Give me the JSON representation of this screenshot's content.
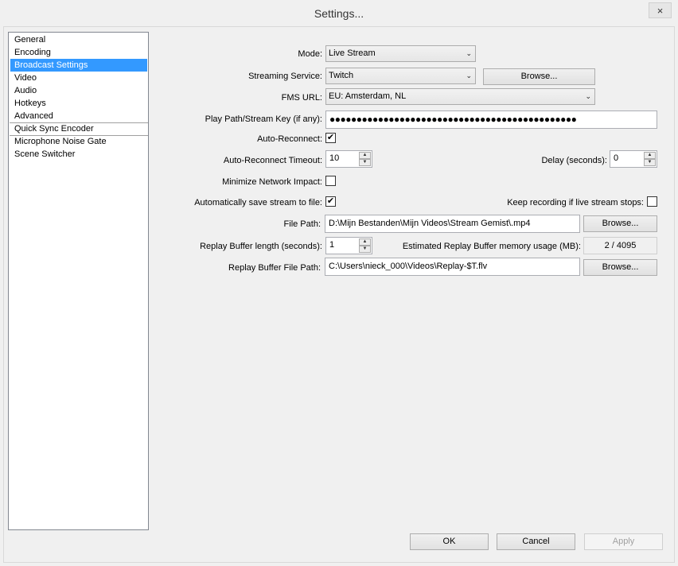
{
  "window": {
    "title": "Settings...",
    "close_glyph": "×"
  },
  "nav": {
    "items": [
      {
        "label": "General"
      },
      {
        "label": "Encoding"
      },
      {
        "label": "Broadcast Settings"
      },
      {
        "label": "Video"
      },
      {
        "label": "Audio"
      },
      {
        "label": "Hotkeys"
      },
      {
        "label": "Advanced"
      },
      {
        "label": "Quick Sync Encoder"
      },
      {
        "label": "Microphone Noise Gate"
      },
      {
        "label": "Scene Switcher"
      }
    ],
    "selected": "Broadcast Settings"
  },
  "form": {
    "mode": {
      "label": "Mode:",
      "value": "Live Stream"
    },
    "service": {
      "label": "Streaming Service:",
      "value": "Twitch",
      "browse": "Browse..."
    },
    "fms": {
      "label": "FMS URL:",
      "value": "EU: Amsterdam, NL"
    },
    "key": {
      "label": "Play Path/Stream Key (if any):",
      "value": "●●●●●●●●●●●●●●●●●●●●●●●●●●●●●●●●●●●●●●●●●●●●●●"
    },
    "autoreconnect": {
      "label": "Auto-Reconnect:",
      "checked": true
    },
    "timeout": {
      "label": "Auto-Reconnect Timeout:",
      "value": "10"
    },
    "delay": {
      "label": "Delay (seconds):",
      "value": "0"
    },
    "minimize": {
      "label": "Minimize Network Impact:",
      "checked": false
    },
    "autosave": {
      "label": "Automatically save stream to file:",
      "checked": true
    },
    "keeprec": {
      "label": "Keep recording if live stream stops:",
      "checked": false
    },
    "filepath": {
      "label": "File Path:",
      "value": "D:\\Mijn Bestanden\\Mijn Videos\\Stream Gemist\\.mp4",
      "browse": "Browse..."
    },
    "replaylen": {
      "label": "Replay Buffer length (seconds):",
      "value": "1"
    },
    "replaymem": {
      "label": "Estimated Replay Buffer memory usage (MB):",
      "value": "2 / 4095"
    },
    "replaypath": {
      "label": "Replay Buffer File Path:",
      "value": "C:\\Users\\nieck_000\\Videos\\Replay-$T.flv",
      "browse": "Browse..."
    }
  },
  "footer": {
    "ok": "OK",
    "cancel": "Cancel",
    "apply": "Apply"
  },
  "icons": {
    "checkmark": "✔",
    "combo_arrow": "⌄",
    "spin_up": "▲",
    "spin_down": "▼"
  }
}
